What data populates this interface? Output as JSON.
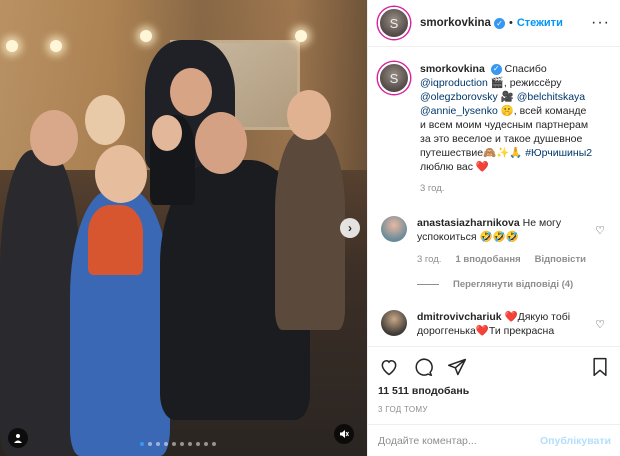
{
  "post": {
    "username": "smorkovkina",
    "follow_label": "Стежити",
    "more_icon": "more-horizontal-icon",
    "caption": {
      "author": "smorkovkina",
      "p1": "Спасибо",
      "mention1": "@iqproduction",
      "p2": "🎬, режиссёру",
      "mention2": "@olegzborovsky",
      "p3": "🎥",
      "mention3": "@belchitskaya",
      "mention4": "@annie_lysenko",
      "p4": "🤫, всей команде и всем моим чудесным партнерам за это веселое и такое душевное путешествие🙈✨🙏",
      "hashtag": "#Юрчишины2",
      "p5": "люблю вас ❤️"
    },
    "caption_time": "3 год."
  },
  "comments": [
    {
      "username": "anastasiazharnikova",
      "text": "Не могу успокоиться 🤣🤣🤣",
      "time": "3 год.",
      "likes": "1 вподобання",
      "reply_label": "Відповісти",
      "view_replies": "Переглянути відповіді (4)"
    },
    {
      "username": "dmitrovivchariuk",
      "text": "❤️Дякую тобі дороггенька❤️Ти прекрасна"
    }
  ],
  "actions": {
    "likes_count": "11 511 вподобань",
    "post_time": "3 ГОД ТОМУ"
  },
  "composer": {
    "placeholder": "Додайте коментар...",
    "publish_label": "Опублікувати"
  },
  "colors": {
    "accent": "#0095f6",
    "verified": "#3897f0",
    "heart": "#ed4956"
  }
}
